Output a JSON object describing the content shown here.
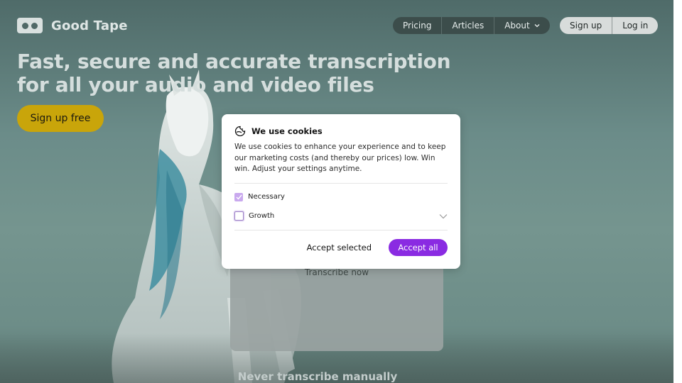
{
  "header": {
    "logo_text": "Good Tape",
    "nav": [
      {
        "label": "Pricing"
      },
      {
        "label": "Articles"
      },
      {
        "label": "About"
      }
    ],
    "auth": {
      "signup_label": "Sign up",
      "login_label": "Log in"
    }
  },
  "hero": {
    "title_line1": "Fast, secure and accurate transcription",
    "title_line2": "for all your audio and video files",
    "cta_label": "Sign up free"
  },
  "upload": {
    "transcribe_label": "Transcribe now"
  },
  "section": {
    "next_heading": "Never transcribe manually"
  },
  "cookie": {
    "title": "We use cookies",
    "description": "We use cookies to enhance your experience and to keep our marketing costs (and thereby our prices) low. Win win. Adjust your settings anytime.",
    "options": [
      {
        "label": "Necessary",
        "checked": true
      },
      {
        "label": "Growth",
        "checked": false
      }
    ],
    "accept_selected_label": "Accept selected",
    "accept_all_label": "Accept all"
  },
  "colors": {
    "accent": "#8a2be2",
    "cta_yellow": "#c9a50a",
    "background": "#6b8c89"
  }
}
